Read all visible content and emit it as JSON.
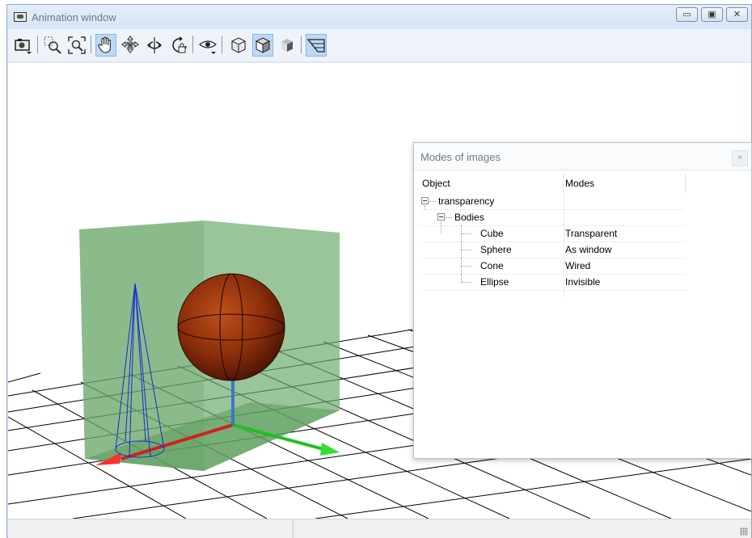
{
  "window": {
    "title": "Animation window",
    "controls": {
      "minimize": "▭",
      "maximize": "▣",
      "close": "✕"
    }
  },
  "toolbar": {
    "items": [
      {
        "icon": "camera-icon"
      },
      {
        "icon": "zoom-region-icon"
      },
      {
        "icon": "zoom-fit-icon"
      },
      {
        "icon": "hand-pan-icon",
        "active": true
      },
      {
        "icon": "move-icon"
      },
      {
        "icon": "rotate-icon"
      },
      {
        "icon": "rotate-lock-icon"
      },
      {
        "icon": "eye-icon"
      },
      {
        "icon": "wireframe-cube-icon"
      },
      {
        "icon": "shaded-cube-icon",
        "active": true
      },
      {
        "icon": "solid-cube-icon"
      },
      {
        "icon": "perspective-icon",
        "active": true
      }
    ]
  },
  "dialog": {
    "title": "Modes of images",
    "close": "×",
    "columns": {
      "object": "Object",
      "modes": "Modes"
    },
    "root": "transparency",
    "group": "Bodies",
    "rows": [
      {
        "object": "Cube",
        "mode": "Transparent"
      },
      {
        "object": "Sphere",
        "mode": "As window"
      },
      {
        "object": "Cone",
        "mode": "Wired"
      },
      {
        "object": "Ellipse",
        "mode": "Invisible"
      }
    ]
  },
  "colors": {
    "accent": "#bcd9f5",
    "cube": "#6aa86a",
    "sphere": "#8a2e0a",
    "cone": "#1a2bd6",
    "axis_x": "#e02020",
    "axis_y": "#20c020",
    "axis_z": "#3a78c9"
  }
}
